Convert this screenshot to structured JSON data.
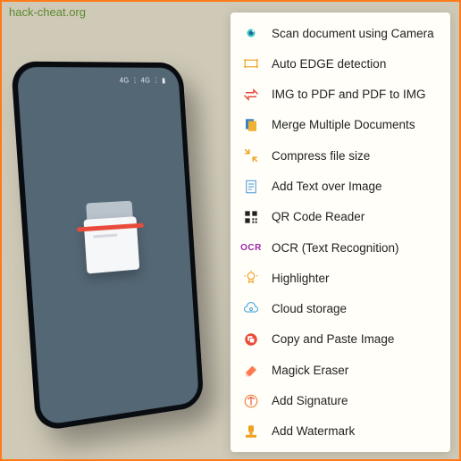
{
  "url": "hack-cheat.org",
  "status_bar": "4G ⋮  4G ⋮  ▮",
  "features": [
    {
      "icon": "camera-scan-icon",
      "label": "Scan document using Camera"
    },
    {
      "icon": "edge-detection-icon",
      "label": "Auto EDGE detection"
    },
    {
      "icon": "convert-icon",
      "label": "IMG to PDF and PDF to IMG"
    },
    {
      "icon": "merge-docs-icon",
      "label": "Merge Multiple Documents"
    },
    {
      "icon": "compress-icon",
      "label": "Compress file size"
    },
    {
      "icon": "add-text-icon",
      "label": "Add Text over Image"
    },
    {
      "icon": "qr-code-icon",
      "label": "QR Code Reader"
    },
    {
      "icon": "ocr-icon",
      "label": "OCR (Text Recognition)"
    },
    {
      "icon": "highlighter-icon",
      "label": "Highlighter"
    },
    {
      "icon": "cloud-storage-icon",
      "label": "Cloud storage"
    },
    {
      "icon": "copy-paste-icon",
      "label": "Copy and Paste Image"
    },
    {
      "icon": "eraser-icon",
      "label": "Magick Eraser"
    },
    {
      "icon": "signature-icon",
      "label": "Add Signature"
    },
    {
      "icon": "watermark-icon",
      "label": "Add Watermark"
    }
  ],
  "ocr_badge": "OCR",
  "colors": {
    "accent": "#ff7a1a",
    "panel_bg": "#fffef8",
    "phone_screen": "#546775"
  }
}
